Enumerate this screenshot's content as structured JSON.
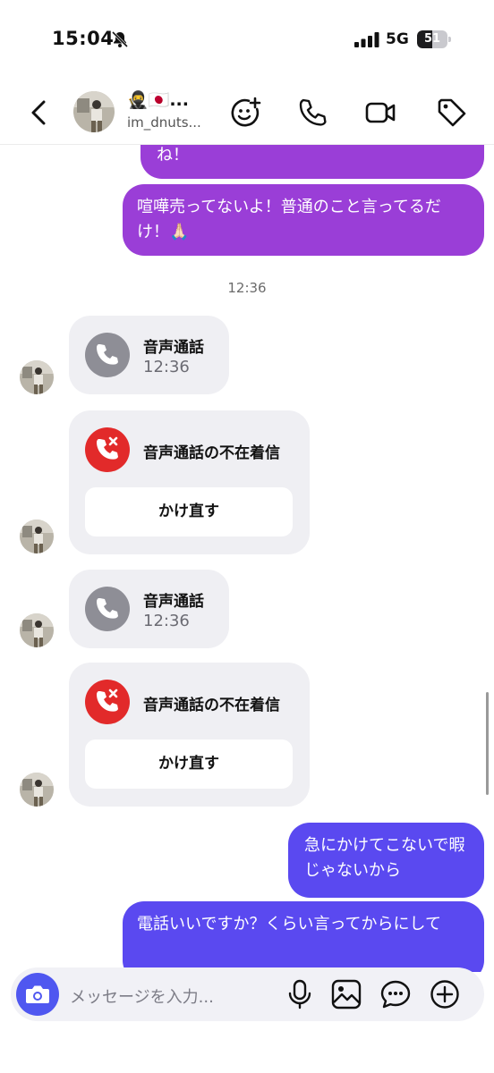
{
  "status_bar": {
    "time": "15:04",
    "network": "5G",
    "battery": "51",
    "battery_level": 0.51
  },
  "header": {
    "display_name": "🥷🇯🇵...",
    "username": "im_dnuts..."
  },
  "messages": {
    "sent_1": "ね！",
    "sent_2": "喧嘩売ってないよ！普通のこと言ってるだけ！🙏🏻",
    "timestamp_1": "12:36",
    "call_1": {
      "title": "音声通話",
      "time": "12:36"
    },
    "missed_1": {
      "title": "音声通話の不在着信",
      "button": "かけ直す"
    },
    "call_2": {
      "title": "音声通話",
      "time": "12:36"
    },
    "missed_2": {
      "title": "音声通話の不在着信",
      "button": "かけ直す"
    },
    "sent_3": "急にかけてこないで暇じゃないから",
    "sent_4": "電話いいですか？くらい言ってからにして"
  },
  "composer": {
    "placeholder": "メッセージを入力..."
  },
  "colors": {
    "bubble_purple": "#9a3ed7",
    "bubble_blue": "#5a49f0",
    "missed_red": "#e22a2a",
    "call_gray": "#8e8e96",
    "accent": "#4f57f0"
  },
  "icons": [
    "bell-slash-icon",
    "signal-icon",
    "back-chevron-icon",
    "sticker-add-icon",
    "phone-icon",
    "video-icon",
    "tag-icon",
    "camera-icon",
    "microphone-icon",
    "image-icon",
    "chat-dots-icon",
    "plus-circle-icon"
  ]
}
